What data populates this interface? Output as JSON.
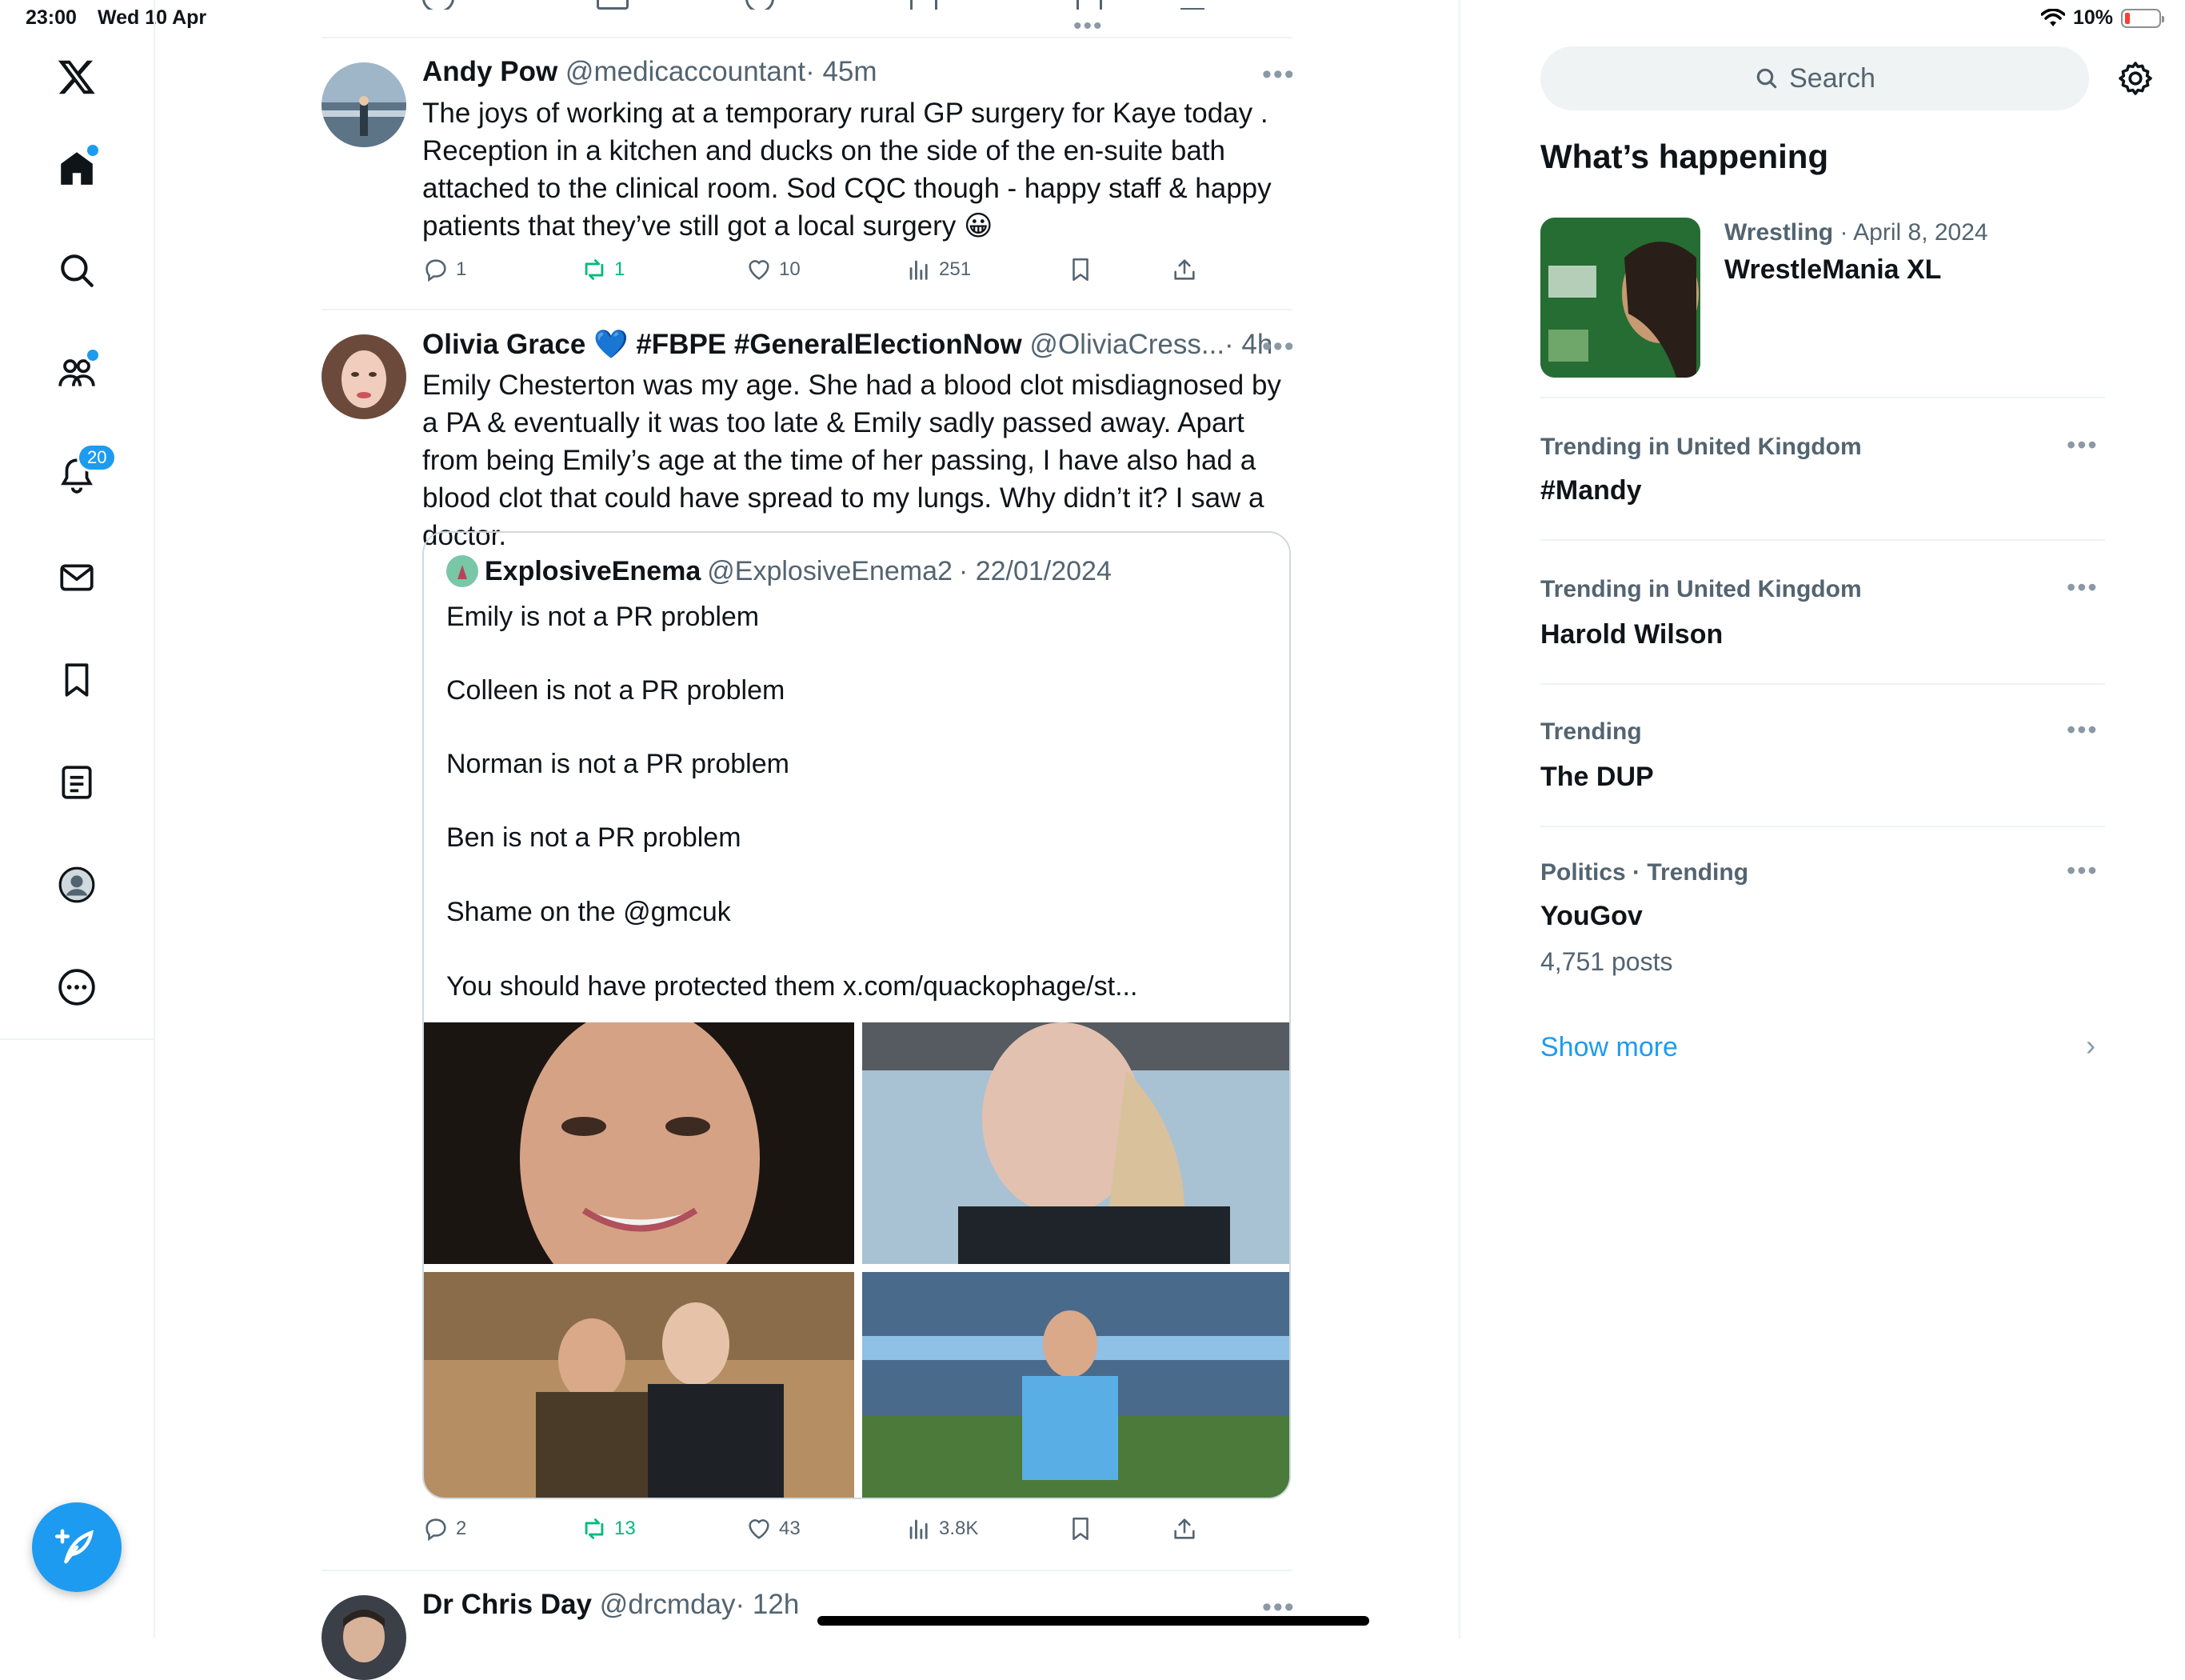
{
  "status_bar": {
    "time": "23:00",
    "date": "Wed 10 Apr",
    "battery": "10%"
  },
  "nav": {
    "notifications_badge": "20"
  },
  "tweets": [
    {
      "name": "Andy Pow",
      "handle": "@medicaccountant",
      "time": "· 45m",
      "body": "The joys of working at a temporary rural GP surgery for Kaye today . Reception in a kitchen and ducks on the side of the en-suite bath attached to the clinical room. Sod CQC though - happy staff & happy patients that they’ve still got a local surgery 😀",
      "replies": "1",
      "reposts": "1",
      "likes": "10",
      "views": "251"
    },
    {
      "name": "Olivia Grace 💙 #FBPE #GeneralElectionNow",
      "handle": "@OliviaCress...",
      "time": "· 4h",
      "body": "Emily Chesterton was my age. She had a blood clot misdiagnosed by a PA & eventually it was too late & Emily sadly passed away. Apart from being Emily’s age at the time of her passing, I have also had a blood clot that could have spread to my lungs. Why didn’t it? I saw a doctor.",
      "quote": {
        "name": "ExplosiveEnema",
        "handle": "@ExplosiveEnema2",
        "time": "· 22/01/2024",
        "lines": [
          "Emily is not a PR problem",
          "Colleen is not a PR problem",
          "Norman is not a PR problem",
          "Ben is not a PR problem",
          "Shame on the @gmcuk",
          "You should have protected them x.com/quackophage/st..."
        ]
      },
      "replies": "2",
      "reposts": "13",
      "likes": "43",
      "views": "3.8K"
    },
    {
      "name": "Dr Chris Day",
      "handle": "@drcmday",
      "time": "· 12h"
    }
  ],
  "right": {
    "search_placeholder": "Search",
    "title": "What’s happening",
    "event": {
      "category": "Wrestling",
      "date": "· April 8, 2024",
      "title": "WrestleMania XL"
    },
    "trends": [
      {
        "context": "Trending in United Kingdom",
        "title": "#Mandy"
      },
      {
        "context": "Trending in United Kingdom",
        "title": "Harold Wilson"
      },
      {
        "context": "Trending",
        "title": "The DUP"
      },
      {
        "context": "Politics · Trending",
        "title": "YouGov",
        "posts": "4,751 posts"
      }
    ],
    "show_more": "Show more"
  },
  "colors": {
    "accent": "#1d9bf0",
    "repost": "#00ba7c",
    "text": "#0f1419",
    "muted": "#536471"
  }
}
